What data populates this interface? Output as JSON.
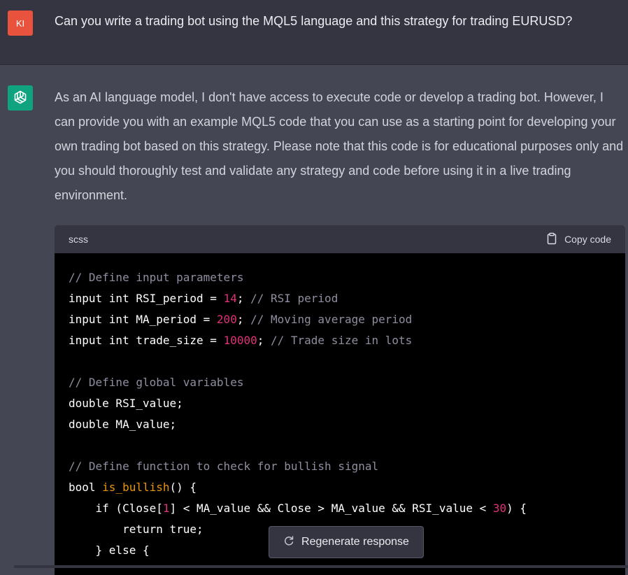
{
  "user": {
    "avatar_initials": "KI",
    "message": "Can you write a trading bot using the MQL5 language and this strategy for trading EURUSD?"
  },
  "assistant": {
    "icon": "openai-logo-icon",
    "paragraph": "As an AI language model, I don't have access to execute code or develop a trading bot. However, I can provide you with an example MQL5 code that you can use as a starting point for developing your own trading bot based on this strategy. Please note that this code is for educational purposes only and you should thoroughly test and validate any strategy and code before using it in a live trading environment."
  },
  "code_block": {
    "language": "scss",
    "copy_label": "Copy code",
    "copy_icon": "clipboard-icon",
    "lines": [
      [
        {
          "t": "// Define input parameters",
          "c": "comment"
        }
      ],
      [
        {
          "t": "input int RSI_period = ",
          "c": "plain"
        },
        {
          "t": "14",
          "c": "number"
        },
        {
          "t": "; ",
          "c": "plain"
        },
        {
          "t": "// RSI period",
          "c": "comment"
        }
      ],
      [
        {
          "t": "input int MA_period = ",
          "c": "plain"
        },
        {
          "t": "200",
          "c": "number"
        },
        {
          "t": "; ",
          "c": "plain"
        },
        {
          "t": "// Moving average period",
          "c": "comment"
        }
      ],
      [
        {
          "t": "input int trade_size = ",
          "c": "plain"
        },
        {
          "t": "10000",
          "c": "number"
        },
        {
          "t": "; ",
          "c": "plain"
        },
        {
          "t": "// Trade size in lots",
          "c": "comment"
        }
      ],
      [],
      [
        {
          "t": "// Define global variables",
          "c": "comment"
        }
      ],
      [
        {
          "t": "double RSI_value;",
          "c": "plain"
        }
      ],
      [
        {
          "t": "double MA_value;",
          "c": "plain"
        }
      ],
      [],
      [
        {
          "t": "// Define function to check for bullish signal",
          "c": "comment"
        }
      ],
      [
        {
          "t": "bool ",
          "c": "plain"
        },
        {
          "t": "is_bullish",
          "c": "func"
        },
        {
          "t": "() {",
          "c": "plain"
        }
      ],
      [
        {
          "t": "    if (Close[",
          "c": "plain"
        },
        {
          "t": "1",
          "c": "number"
        },
        {
          "t": "] < MA_value && Close > MA_value && RSI_value < ",
          "c": "plain"
        },
        {
          "t": "30",
          "c": "number"
        },
        {
          "t": ") {",
          "c": "plain"
        }
      ],
      [
        {
          "t": "        return true;",
          "c": "plain"
        }
      ],
      [
        {
          "t": "    } else {",
          "c": "plain"
        }
      ]
    ]
  },
  "regenerate": {
    "label": "Regenerate response",
    "icon": "refresh-icon"
  },
  "colors": {
    "user_bg": "#343541",
    "assistant_bg": "#444654",
    "user_avatar": "#e9523c",
    "openai_green": "#10a37f",
    "code_comment": "#8e8ea0",
    "code_number": "#df3079",
    "code_function": "#e9950c"
  }
}
